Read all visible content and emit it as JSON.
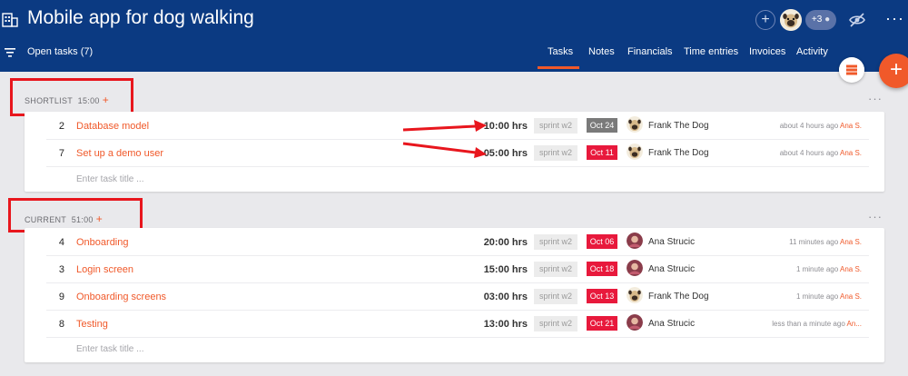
{
  "header": {
    "title": "Mobile app for dog walking",
    "member_overflow": "+3",
    "open_tasks_label": "Open tasks (7)",
    "tabs": [
      {
        "label": "Tasks",
        "active": true
      },
      {
        "label": "Notes",
        "active": false
      },
      {
        "label": "Financials",
        "active": false
      },
      {
        "label": "Time entries",
        "active": false
      },
      {
        "label": "Invoices",
        "active": false
      },
      {
        "label": "Activity",
        "active": false
      }
    ],
    "icons": [
      "building-icon",
      "add-member-icon",
      "eye-slash-icon",
      "more-icon",
      "filter-icon"
    ]
  },
  "colors": {
    "header_bg": "#0b3a82",
    "accent": "#f0592a",
    "date_red": "#e8193c",
    "date_gray": "#7a7a7a",
    "annotation": "#e8161d"
  },
  "sections": [
    {
      "name": "SHORTLIST",
      "total": "15:00",
      "enter_placeholder": "Enter task title ...",
      "tasks": [
        {
          "num": "2",
          "title": "Database model",
          "hours": "10:00 hrs",
          "sprint": "sprint w2",
          "date": "Oct 24",
          "date_style": "gray",
          "assignee": "Frank The Dog",
          "avatar": "pug",
          "time_ago": "about 4 hours ago",
          "by": "Ana S."
        },
        {
          "num": "7",
          "title": "Set up a demo user",
          "hours": "05:00 hrs",
          "sprint": "sprint w2",
          "date": "Oct 11",
          "date_style": "red",
          "assignee": "Frank The Dog",
          "avatar": "pug",
          "time_ago": "about 4 hours ago",
          "by": "Ana S."
        }
      ]
    },
    {
      "name": "CURRENT",
      "total": "51:00",
      "enter_placeholder": "Enter task title ...",
      "tasks": [
        {
          "num": "4",
          "title": "Onboarding",
          "hours": "20:00 hrs",
          "sprint": "sprint w2",
          "date": "Oct 06",
          "date_style": "red",
          "assignee": "Ana Strucic",
          "avatar": "person",
          "time_ago": "11 minutes ago",
          "by": "Ana S."
        },
        {
          "num": "3",
          "title": "Login screen",
          "hours": "15:00 hrs",
          "sprint": "sprint w2",
          "date": "Oct 18",
          "date_style": "red",
          "assignee": "Ana Strucic",
          "avatar": "person",
          "time_ago": "1 minute ago",
          "by": "Ana S."
        },
        {
          "num": "9",
          "title": "Onboarding screens",
          "hours": "03:00 hrs",
          "sprint": "sprint w2",
          "date": "Oct 13",
          "date_style": "red",
          "assignee": "Frank The Dog",
          "avatar": "pug",
          "time_ago": "1 minute ago",
          "by": "Ana S."
        },
        {
          "num": "8",
          "title": "Testing",
          "hours": "13:00 hrs",
          "sprint": "sprint w2",
          "date": "Oct 21",
          "date_style": "red",
          "assignee": "Ana Strucic",
          "avatar": "person",
          "time_ago": "less than a minute ago",
          "by": "An..."
        }
      ]
    }
  ]
}
